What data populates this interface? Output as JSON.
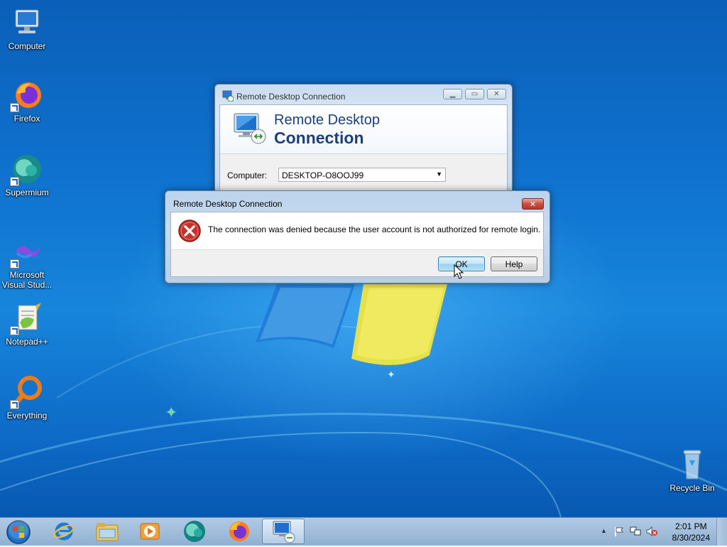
{
  "desktop_icons": [
    {
      "label": "Computer",
      "icon": "computer-icon"
    },
    {
      "label": "Firefox",
      "icon": "firefox-icon"
    },
    {
      "label": "Supermium",
      "icon": "supermium-icon"
    },
    {
      "label": "Microsoft Visual Stud...",
      "icon": "visual-studio-icon"
    },
    {
      "label": "Notepad++",
      "icon": "notepadpp-icon"
    },
    {
      "label": "Everything",
      "icon": "everything-icon"
    },
    {
      "label": "Recycle Bin",
      "icon": "recycle-bin-icon"
    }
  ],
  "rdc_window": {
    "title": "Remote Desktop Connection",
    "banner_line1": "Remote Desktop",
    "banner_line2": "Connection",
    "computer_label": "Computer:",
    "computer_value": "DESKTOP-O8OOJ99"
  },
  "error_dialog": {
    "title": "Remote Desktop Connection",
    "message": "The connection was denied because the user account is not authorized for remote login.",
    "ok_label": "OK",
    "help_label": "Help"
  },
  "taskbar": {
    "items": [
      "internet-explorer-icon",
      "file-explorer-icon",
      "media-player-icon",
      "supermium-icon",
      "firefox-icon",
      "remote-desktop-icon"
    ],
    "active_item": "remote-desktop-icon",
    "clock_time": "2:01 PM",
    "clock_date": "8/30/2024"
  },
  "colors": {
    "desktop_blue": "#0f73cf",
    "banner_text": "#1d3f7a",
    "close_red": "#c7503f",
    "ok_focus": "#3c7fb1"
  }
}
